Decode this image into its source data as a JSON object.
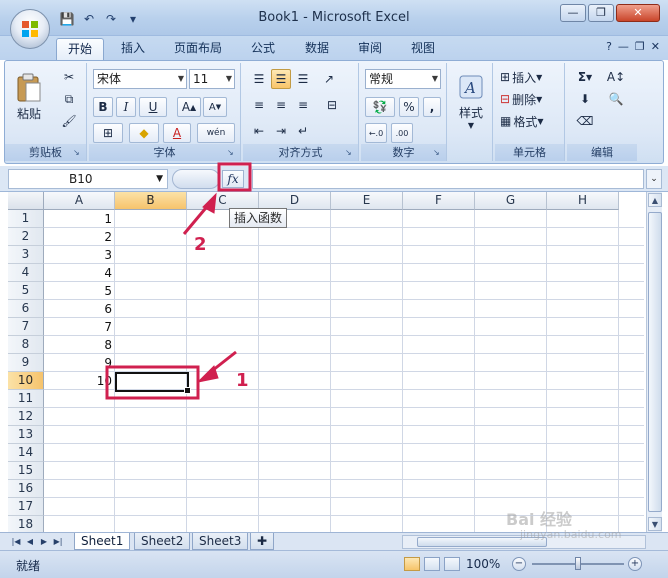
{
  "window": {
    "title": "Book1 - Microsoft Excel",
    "controls": [
      "—",
      "❐",
      "✕"
    ]
  },
  "qat": [
    "💾",
    "↶",
    "↷",
    "▾"
  ],
  "tabs": [
    "开始",
    "插入",
    "页面布局",
    "公式",
    "数据",
    "审阅",
    "视图"
  ],
  "tab_right": [
    "?",
    "—",
    "❐",
    "✕"
  ],
  "ribbon": {
    "clipboard": {
      "label": "剪贴板",
      "paste": "粘贴"
    },
    "font": {
      "label": "字体",
      "font_name": "宋体",
      "font_size": "11",
      "bold": "B",
      "italic": "I",
      "underline": "U",
      "grow": "A",
      "shrink": "A",
      "font_color": "A",
      "phonetic": "wén"
    },
    "alignment": {
      "label": "对齐方式"
    },
    "number": {
      "label": "数字",
      "format": "常规",
      "percent": "%",
      "comma": ","
    },
    "styles": {
      "label": "样式",
      "styles_btn": "样式"
    },
    "cells": {
      "label": "单元格",
      "insert": "插入",
      "delete": "删除",
      "format": "格式"
    },
    "editing": {
      "label": "编辑",
      "sum": "Σ"
    }
  },
  "formula_bar": {
    "name_box": "B10",
    "fx": "fx",
    "formula": ""
  },
  "tooltip": "插入函数",
  "grid": {
    "columns": [
      "A",
      "B",
      "C",
      "D",
      "E",
      "F",
      "G",
      "H"
    ],
    "rows": [
      "1",
      "2",
      "3",
      "4",
      "5",
      "6",
      "7",
      "8",
      "9",
      "10",
      "11",
      "12",
      "13",
      "14",
      "15",
      "16",
      "17",
      "18"
    ],
    "values_A": [
      "1",
      "2",
      "3",
      "4",
      "5",
      "6",
      "7",
      "8",
      "9",
      "10"
    ],
    "selected_cell": "B10"
  },
  "sheets": [
    "Sheet1",
    "Sheet2",
    "Sheet3"
  ],
  "status": {
    "text": "就绪",
    "zoom": "100%"
  },
  "annotations": {
    "one": "1",
    "two": "2",
    "color": "#d0204f"
  },
  "watermark": {
    "main": "Bai 经验",
    "sub": "jingyan.baidu.com"
  }
}
